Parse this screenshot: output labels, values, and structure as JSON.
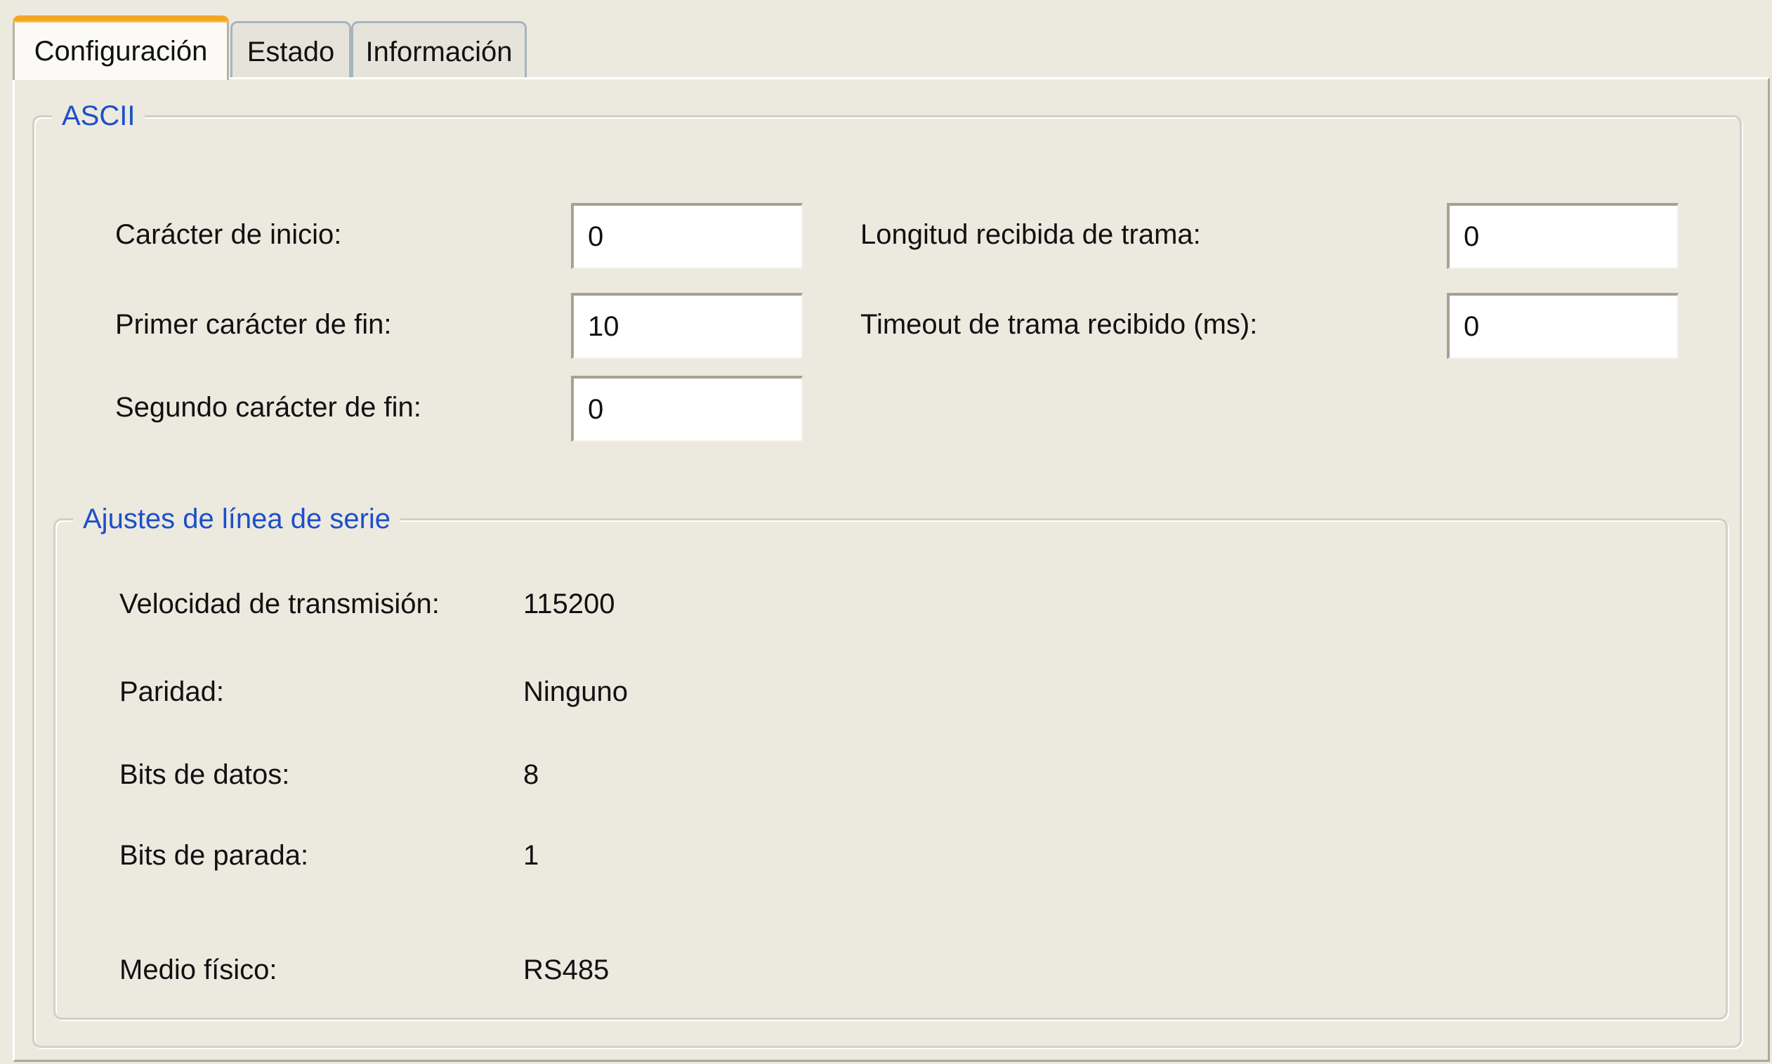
{
  "tabs": [
    {
      "label": "Configuración",
      "active": true
    },
    {
      "label": "Estado",
      "active": false
    },
    {
      "label": "Información",
      "active": false
    }
  ],
  "ascii": {
    "legend": "ASCII",
    "start_char": {
      "label": "Carácter de inicio:",
      "value": "0"
    },
    "first_end_char": {
      "label": "Primer carácter de fin:",
      "value": "10"
    },
    "second_end_char": {
      "label": "Segundo carácter de fin:",
      "value": "0"
    },
    "frame_length": {
      "label": "Longitud recibida de trama:",
      "value": "0"
    },
    "frame_timeout": {
      "label": "Timeout de trama recibido (ms):",
      "value": "0"
    }
  },
  "serial": {
    "legend": "Ajustes de línea de serie",
    "baud_rate": {
      "label": "Velocidad de transmisión:",
      "value": "115200"
    },
    "parity": {
      "label": "Paridad:",
      "value": "Ninguno"
    },
    "data_bits": {
      "label": "Bits de datos:",
      "value": "8"
    },
    "stop_bits": {
      "label": "Bits de parada:",
      "value": "1"
    },
    "physical_medium": {
      "label": "Medio físico:",
      "value": "RS485"
    }
  },
  "colors": {
    "background": "#ece9df",
    "legend_text": "#1d4fc9",
    "active_tab_accent": "#f5a623"
  }
}
